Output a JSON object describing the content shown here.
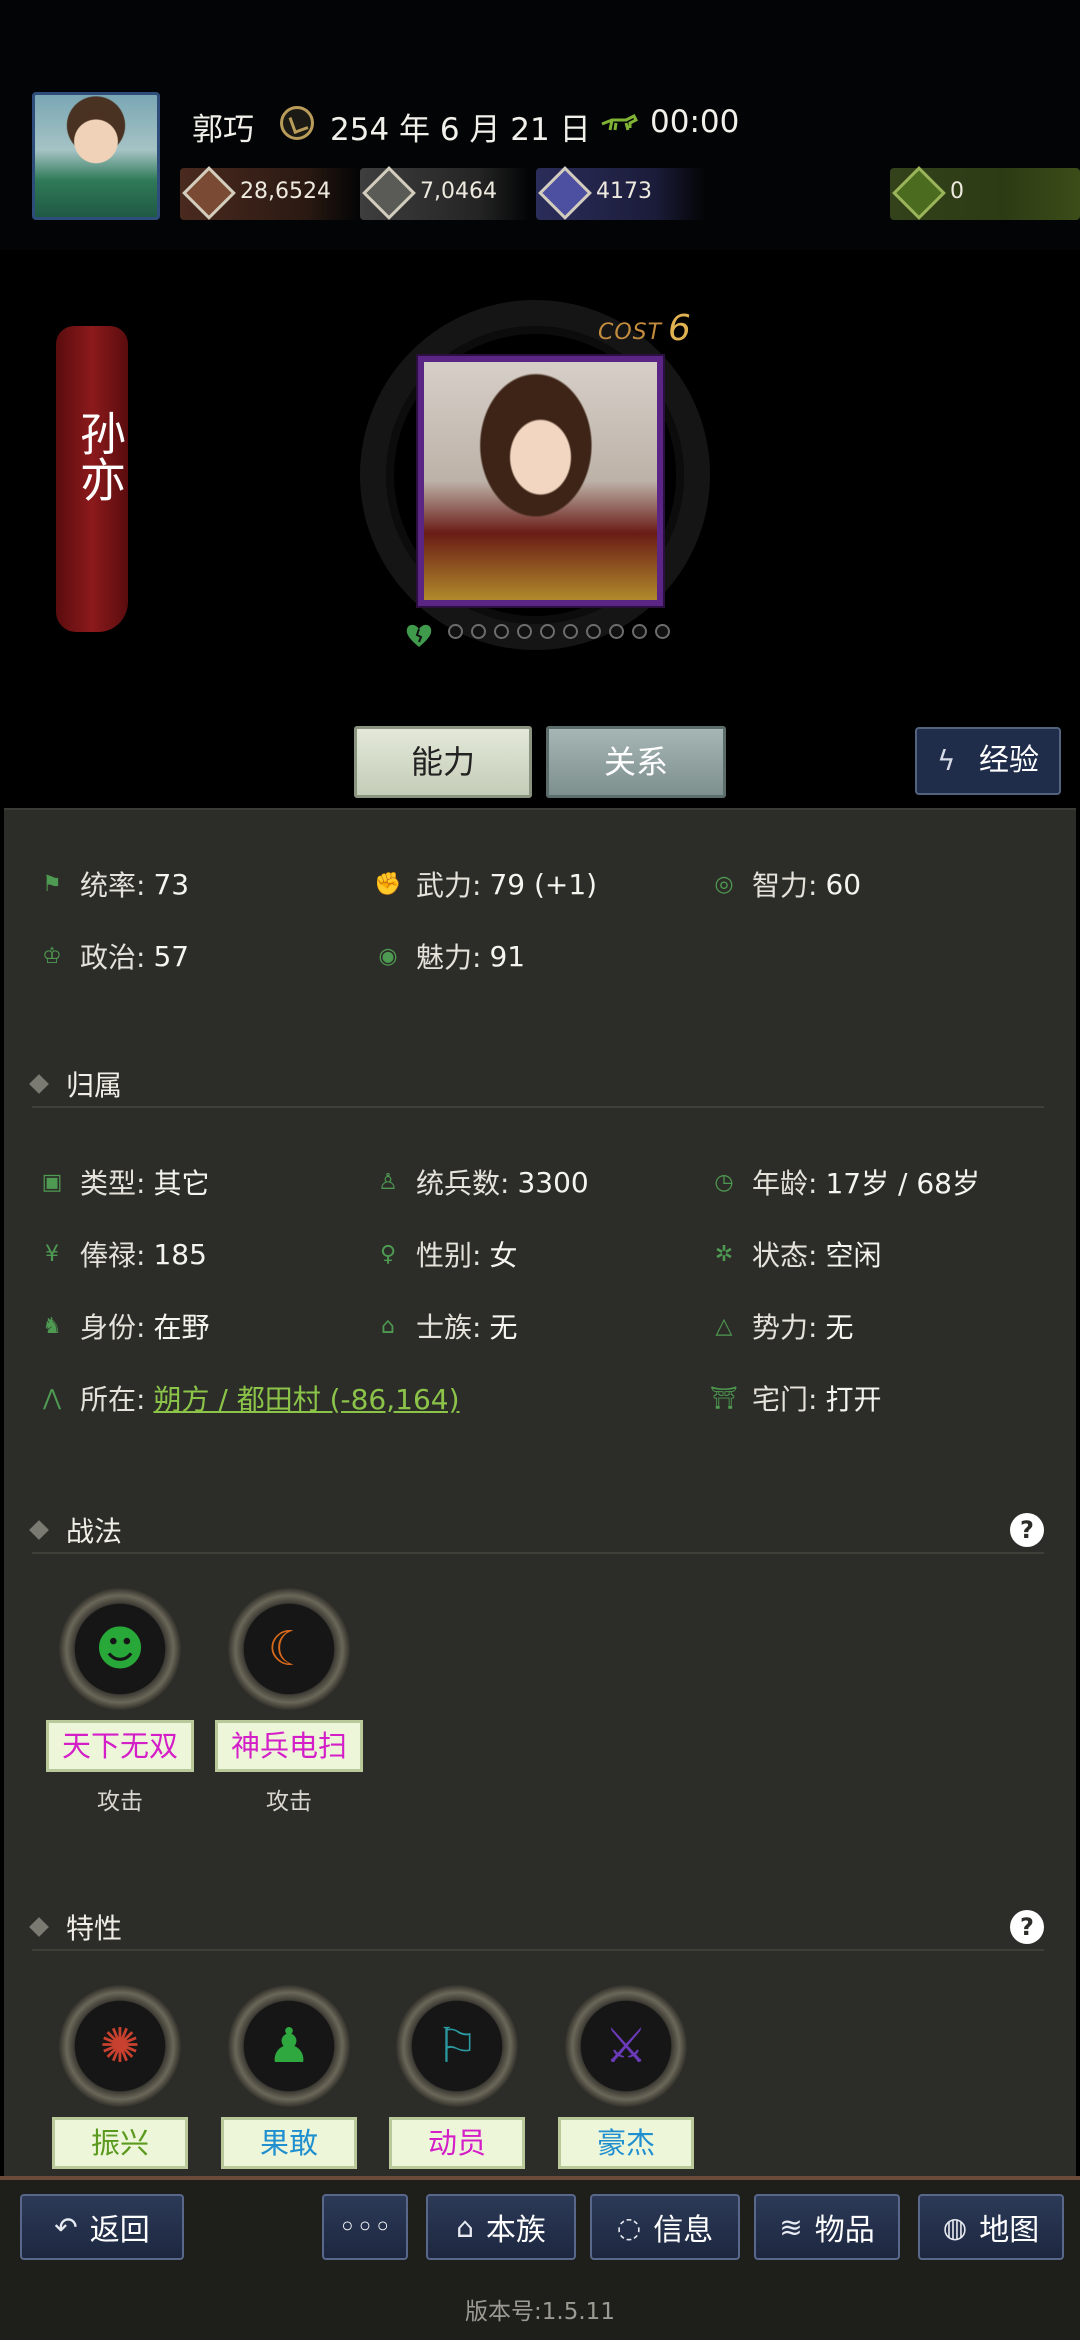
{
  "header": {
    "player_name": "郭巧",
    "date": "254 年 6 月 21 日",
    "time": "00:00",
    "resources": {
      "money": "28,6524",
      "food": "7,0464",
      "troops": "4173",
      "bag": "0"
    }
  },
  "hero": {
    "name": "孙亦",
    "cost_label": "COST",
    "cost_value": "6",
    "rank_dots": 10
  },
  "tabs": {
    "ability": "能力",
    "relation": "关系",
    "experience": "经验"
  },
  "stats": {
    "command": {
      "label": "统率",
      "value": "73"
    },
    "force": {
      "label": "武力",
      "value": "79 (+1)"
    },
    "intelligence": {
      "label": "智力",
      "value": "60"
    },
    "politics": {
      "label": "政治",
      "value": "57"
    },
    "charm": {
      "label": "魅力",
      "value": "91"
    }
  },
  "affiliation": {
    "title": "归属",
    "type": {
      "label": "类型",
      "value": "其它"
    },
    "troop_count": {
      "label": "统兵数",
      "value": "3300"
    },
    "age": {
      "label": "年龄",
      "value": "17岁 / 68岁"
    },
    "salary": {
      "label": "俸禄",
      "value": "185"
    },
    "gender": {
      "label": "性别",
      "value": "女"
    },
    "status": {
      "label": "状态",
      "value": "空闲"
    },
    "identity": {
      "label": "身份",
      "value": "在野"
    },
    "clan": {
      "label": "士族",
      "value": "无"
    },
    "faction": {
      "label": "势力",
      "value": "无"
    },
    "location": {
      "label": "所在",
      "value": "朔方 / 都田村 (-86,164)"
    },
    "gate": {
      "label": "宅门",
      "value": "打开"
    }
  },
  "tactics": {
    "title": "战法",
    "items": [
      {
        "name": "天下无双",
        "type": "攻击",
        "color": "#d41ec8"
      },
      {
        "name": "神兵电扫",
        "type": "攻击",
        "color": "#d41ec8"
      }
    ]
  },
  "traits": {
    "title": "特性",
    "items": [
      {
        "name": "振兴",
        "color": "#5a9a1e"
      },
      {
        "name": "果敢",
        "color": "#1f8fcf"
      },
      {
        "name": "动员",
        "color": "#d41ec8"
      },
      {
        "name": "豪杰",
        "color": "#1f8fcf"
      }
    ]
  },
  "bottom_nav": {
    "back": "返回",
    "more": "◦◦◦",
    "clan": "本族",
    "info": "信息",
    "items": "物品",
    "map": "地图"
  },
  "version": "版本号:1.5.11"
}
